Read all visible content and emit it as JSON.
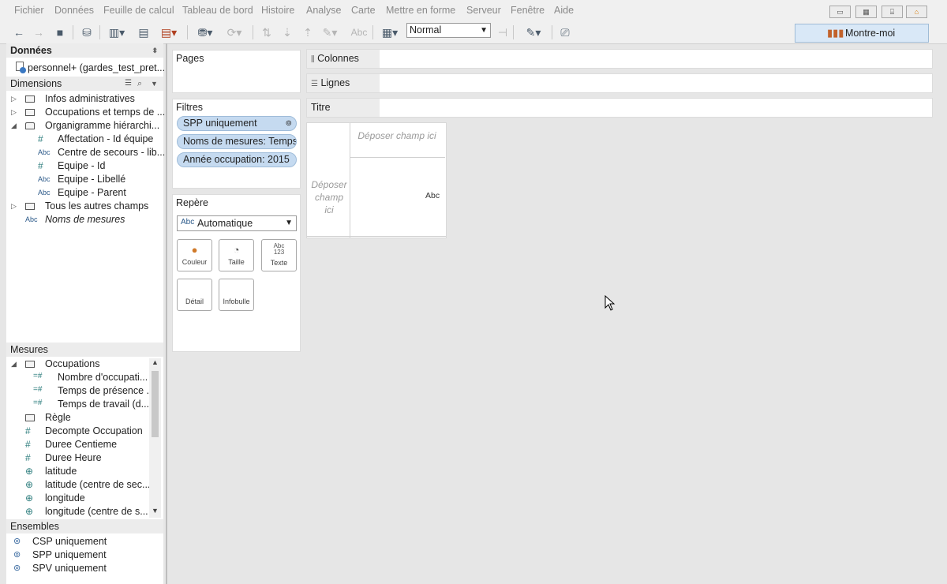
{
  "menu": [
    "Fichier",
    "Données",
    "Feuille de calcul",
    "Tableau de bord",
    "Histoire",
    "Analyse",
    "Carte",
    "Mettre en forme",
    "Serveur",
    "Fenêtre",
    "Aide"
  ],
  "toolbar": {
    "fit_select": "Normal",
    "abc_label": "Abc",
    "show_me": "Montre-moi"
  },
  "data_panel": {
    "title": "Données",
    "datasource": "personnel+ (gardes_test_pret...",
    "dimensions_title": "Dimensions",
    "dimensions": [
      {
        "label": "Infos administratives",
        "type": "folder",
        "level": 0,
        "expand": "closed"
      },
      {
        "label": "Occupations et temps de ...",
        "type": "folder",
        "level": 0,
        "expand": "closed"
      },
      {
        "label": "Organigramme hiérarchi...",
        "type": "hierarchy",
        "level": 0,
        "expand": "open"
      },
      {
        "label": "Affectation - Id équipe",
        "type": "number",
        "level": 1
      },
      {
        "label": "Centre de secours - lib...",
        "type": "abc",
        "level": 1
      },
      {
        "label": "Equipe - Id",
        "type": "number",
        "level": 1
      },
      {
        "label": "Equipe - Libellé",
        "type": "abc",
        "level": 1
      },
      {
        "label": "Equipe - Parent",
        "type": "abc",
        "level": 1
      },
      {
        "label": "Tous les autres champs",
        "type": "folder",
        "level": 0,
        "expand": "closed"
      },
      {
        "label": "Noms de mesures",
        "type": "abc",
        "level": -1,
        "italic": true
      }
    ],
    "measures_title": "Mesures",
    "measures": [
      {
        "label": "Occupations",
        "type": "folder",
        "level": 0,
        "expand": "open"
      },
      {
        "label": "Nombre d'occupati...",
        "type": "calc",
        "level": 1
      },
      {
        "label": "Temps de présence ...",
        "type": "calc",
        "level": 1
      },
      {
        "label": "Temps de travail (d...",
        "type": "calc",
        "level": 1
      },
      {
        "label": "Règle",
        "type": "folder",
        "level": 0
      },
      {
        "label": "Decompte Occupation",
        "type": "number",
        "level": 0
      },
      {
        "label": "Duree Centieme",
        "type": "number",
        "level": 0
      },
      {
        "label": "Duree Heure",
        "type": "number",
        "level": 0
      },
      {
        "label": "latitude",
        "type": "globe",
        "level": 0
      },
      {
        "label": "latitude (centre de sec...",
        "type": "globe",
        "level": 0
      },
      {
        "label": "longitude",
        "type": "globe",
        "level": 0
      },
      {
        "label": "longitude (centre de s...",
        "type": "globe",
        "level": 0
      }
    ],
    "sets_title": "Ensembles",
    "sets": [
      "CSP uniquement",
      "SPP uniquement",
      "SPV uniquement"
    ]
  },
  "cards": {
    "pages_title": "Pages",
    "filters_title": "Filtres",
    "filters": [
      "SPP uniquement",
      "Noms de mesures: Temps...",
      "Année occupation: 2015"
    ],
    "marks_title": "Repère",
    "mark_type": "Automatique",
    "mark_type_icon": "Abc",
    "mark_buttons": [
      {
        "label": "Couleur",
        "icon": "color-icon"
      },
      {
        "label": "Taille",
        "icon": "size-icon"
      },
      {
        "label": "Texte",
        "icon": "text-icon",
        "glyph": "Abc\n123"
      },
      {
        "label": "Détail",
        "icon": ""
      },
      {
        "label": "Infobulle",
        "icon": ""
      }
    ]
  },
  "shelves": {
    "columns": "Colonnes",
    "rows": "Lignes",
    "title": "Titre"
  },
  "view": {
    "drop_top": "Déposer champ ici",
    "drop_left": "Déposer champ ici",
    "abc": "Abc"
  }
}
